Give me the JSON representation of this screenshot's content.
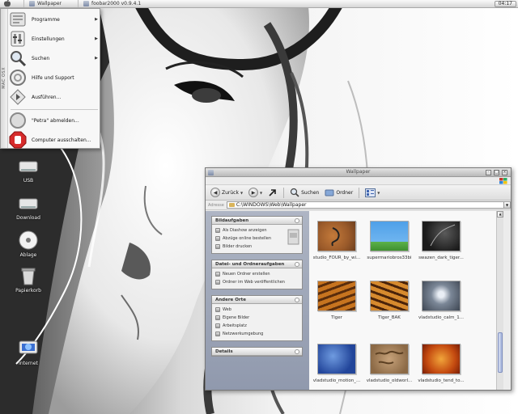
{
  "taskbar": {
    "tasks": [
      {
        "label": "Wallpaper",
        "icon": "folder-icon"
      },
      {
        "label": "foobar2000 v0.9.4.1",
        "icon": "foobar-icon"
      }
    ],
    "clock": "04:17"
  },
  "start_menu": {
    "side_label": "MAC OSX",
    "items": [
      {
        "label": "Programme",
        "icon": "programs-icon",
        "has_submenu": true
      },
      {
        "label": "Einstellungen",
        "icon": "settings-icon",
        "has_submenu": true
      },
      {
        "label": "Suchen",
        "icon": "search-icon",
        "has_submenu": true
      },
      {
        "label": "Hilfe und Support",
        "icon": "help-icon",
        "has_submenu": false
      },
      {
        "label": "Ausführen...",
        "icon": "run-icon",
        "has_submenu": false
      },
      {
        "label": "\"Petra\" abmelden...",
        "icon": "logoff-icon",
        "has_submenu": false
      },
      {
        "label": "Computer ausschalten...",
        "icon": "shutdown-icon",
        "has_submenu": false
      }
    ],
    "arrow": "▶"
  },
  "desktop_icons": [
    {
      "label": "USB",
      "icon": "usb-drive-icon"
    },
    {
      "label": "Download",
      "icon": "download-drive-icon"
    },
    {
      "label": "Ablage",
      "icon": "cd-icon"
    },
    {
      "label": "Papierkorb",
      "icon": "trash-icon"
    },
    {
      "label": "Internet",
      "icon": "internet-icon"
    }
  ],
  "explorer": {
    "title": "Wallpaper",
    "toolbar": {
      "back": "Zurück",
      "search": "Suchen",
      "folders": "Ordner"
    },
    "address": {
      "label": "Adresse",
      "value": "C:\\WINDOWS\\Web\\Wallpaper"
    },
    "panels": [
      {
        "title": "Bildaufgaben",
        "links": [
          "Als Diashow anzeigen",
          "Abzüge online bestellen",
          "Bilder drucken"
        ]
      },
      {
        "title": "Datei- und Ordneraufgaben",
        "links": [
          "Neuen Ordner erstellen",
          "Ordner im Web veröffentlichen"
        ]
      },
      {
        "title": "Andere Orte",
        "links": [
          "Web",
          "Eigene Bilder",
          "Arbeitsplatz",
          "Netzwerkumgebung"
        ]
      },
      {
        "title": "Details",
        "links": []
      }
    ],
    "files": [
      {
        "name": "studio_FOUR_by_wi...",
        "swatch": "swatch-studio"
      },
      {
        "name": "supermariobros33bi",
        "swatch": "swatch-mario"
      },
      {
        "name": "swazen_dark_tiger...",
        "swatch": "swatch-swazen"
      },
      {
        "name": "Tiger",
        "swatch": "swatch-tiger"
      },
      {
        "name": "Tiger_BAK",
        "swatch": "swatch-tigerbak"
      },
      {
        "name": "vladstudio_calm_1...",
        "swatch": "swatch-calm"
      },
      {
        "name": "vladstudio_motion_...",
        "swatch": "swatch-motion"
      },
      {
        "name": "vladstudio_oldworl...",
        "swatch": "swatch-oldworld"
      },
      {
        "name": "vladstudio_tend_to...",
        "swatch": "swatch-tend"
      }
    ]
  },
  "colors": {
    "taskpane": "#9da5b8",
    "file_area": "#f8f8f8",
    "panel_header": "#d5d5d5"
  }
}
